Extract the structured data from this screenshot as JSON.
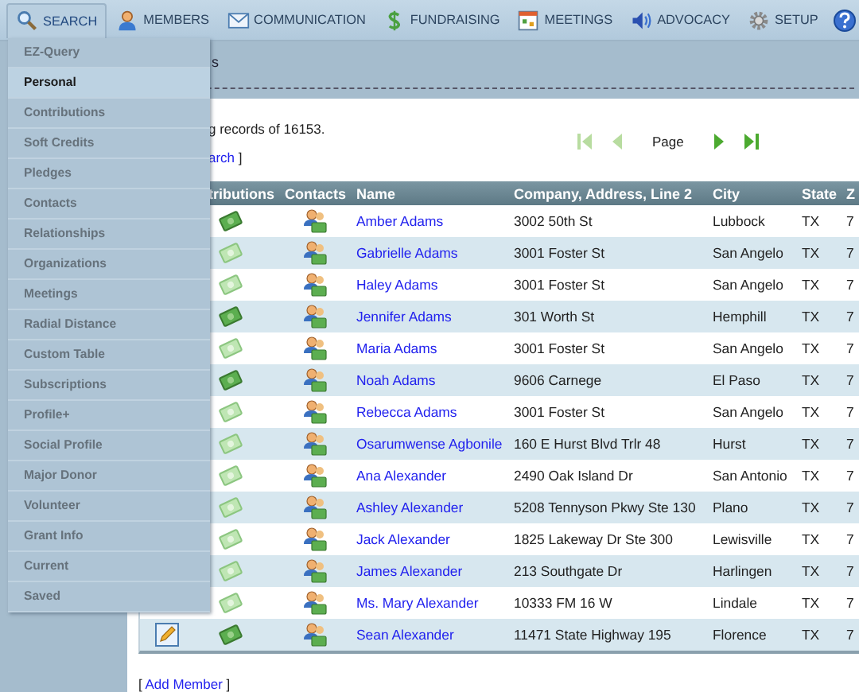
{
  "nav": [
    {
      "label": "SEARCH",
      "selected": true
    },
    {
      "label": "MEMBERS",
      "selected": false
    },
    {
      "label": "COMMUNICATION",
      "selected": false
    },
    {
      "label": "FUNDRAISING",
      "selected": false
    },
    {
      "label": "MEETINGS",
      "selected": false
    },
    {
      "label": "ADVOCACY",
      "selected": false
    },
    {
      "label": "SETUP",
      "selected": false
    }
  ],
  "search_menu": [
    {
      "label": "EZ-Query",
      "selected": false
    },
    {
      "label": "Personal",
      "selected": true
    },
    {
      "label": "Contributions",
      "selected": false
    },
    {
      "label": "Soft Credits",
      "selected": false
    },
    {
      "label": "Pledges",
      "selected": false
    },
    {
      "label": "Contacts",
      "selected": false
    },
    {
      "label": "Relationships",
      "selected": false
    },
    {
      "label": "Organizations",
      "selected": false
    },
    {
      "label": "Meetings",
      "selected": false
    },
    {
      "label": "Radial Distance",
      "selected": false
    },
    {
      "label": "Custom Table",
      "selected": false
    },
    {
      "label": "Subscriptions",
      "selected": false
    },
    {
      "label": "Profile+",
      "selected": false
    },
    {
      "label": "Social Profile",
      "selected": false
    },
    {
      "label": "Major Donor",
      "selected": false
    },
    {
      "label": "Volunteer",
      "selected": false
    },
    {
      "label": "Grant Info",
      "selected": false
    },
    {
      "label": "Current",
      "selected": false
    },
    {
      "label": "Saved",
      "selected": false
    }
  ],
  "sub_tab": "s",
  "records_text": "g records of 16153.",
  "search_link": {
    "link": "arch",
    "after": "]"
  },
  "pager": {
    "label": "Page",
    "first_disabled": true,
    "prev_disabled": true,
    "next_disabled": false,
    "last_disabled": false
  },
  "table": {
    "columns": [
      "",
      "tributions",
      "Contacts",
      "Name",
      "Company, Address, Line 2",
      "City",
      "State",
      "Z"
    ],
    "rows": [
      {
        "contributions": true,
        "name": "Amber Adams",
        "company": "3002 50th St",
        "city": "Lubbock",
        "state": "TX",
        "zip": "7"
      },
      {
        "contributions": false,
        "name": "Gabrielle Adams",
        "company": "3001 Foster St",
        "city": "San Angelo",
        "state": "TX",
        "zip": "7"
      },
      {
        "contributions": false,
        "name": "Haley Adams",
        "company": "3001 Foster St",
        "city": "San Angelo",
        "state": "TX",
        "zip": "7"
      },
      {
        "contributions": true,
        "name": "Jennifer Adams",
        "company": "301 Worth St",
        "city": "Hemphill",
        "state": "TX",
        "zip": "7"
      },
      {
        "contributions": false,
        "name": "Maria Adams",
        "company": "3001 Foster St",
        "city": "San Angelo",
        "state": "TX",
        "zip": "7"
      },
      {
        "contributions": true,
        "name": "Noah Adams",
        "company": "9606 Carnege",
        "city": "El Paso",
        "state": "TX",
        "zip": "7"
      },
      {
        "contributions": false,
        "name": "Rebecca Adams",
        "company": "3001 Foster St",
        "city": "San Angelo",
        "state": "TX",
        "zip": "7"
      },
      {
        "contributions": false,
        "name": "Osarumwense Agbonile",
        "company": "160 E Hurst Blvd Trlr 48",
        "city": "Hurst",
        "state": "TX",
        "zip": "7"
      },
      {
        "contributions": false,
        "name": "Ana Alexander",
        "company": "2490 Oak Island Dr",
        "city": "San Antonio",
        "state": "TX",
        "zip": "7"
      },
      {
        "contributions": false,
        "name": "Ashley Alexander",
        "company": "5208 Tennyson Pkwy Ste 130",
        "city": "Plano",
        "state": "TX",
        "zip": "7"
      },
      {
        "contributions": false,
        "name": "Jack Alexander",
        "company": "1825 Lakeway Dr Ste 300",
        "city": "Lewisville",
        "state": "TX",
        "zip": "7"
      },
      {
        "contributions": false,
        "name": "James Alexander",
        "company": "213 Southgate Dr",
        "city": "Harlingen",
        "state": "TX",
        "zip": "7"
      },
      {
        "contributions": false,
        "name": "Ms. Mary Alexander",
        "company": "10333 FM 16 W",
        "city": "Lindale",
        "state": "TX",
        "zip": "7"
      },
      {
        "contributions": true,
        "name": "Sean Alexander",
        "company": "11471 State Highway 195",
        "city": "Florence",
        "state": "TX",
        "zip": "7"
      }
    ]
  },
  "add_member": {
    "before": "[",
    "link": "Add Member",
    "after": "]"
  }
}
